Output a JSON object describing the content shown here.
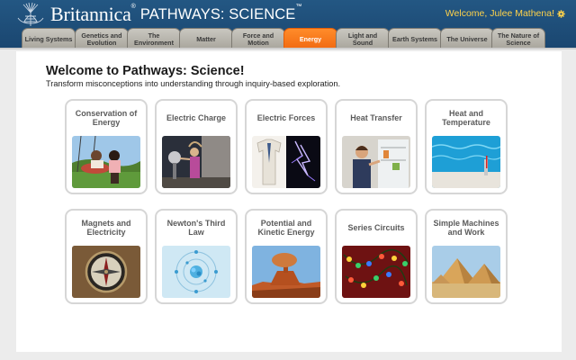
{
  "header": {
    "brand": "Britannica",
    "brand_mark": "®",
    "product": "PATHWAYS: SCIENCE",
    "product_mark": "™",
    "welcome": "Welcome, Julee Mathena!",
    "logo_icon": "thistle-icon",
    "settings_icon": "gear-icon",
    "colors": {
      "header_bg": "#1f4e7a",
      "welcome_text": "#ffd24a",
      "active_tab": "#f26a11"
    }
  },
  "tabs": [
    {
      "label": "Living Systems"
    },
    {
      "label": "Genetics and Evolution"
    },
    {
      "label": "The Environment"
    },
    {
      "label": "Matter"
    },
    {
      "label": "Force and Motion"
    },
    {
      "label": "Energy",
      "active": true
    },
    {
      "label": "Light and Sound"
    },
    {
      "label": "Earth Systems"
    },
    {
      "label": "The Universe"
    },
    {
      "label": "The Nature of Science"
    }
  ],
  "main": {
    "title": "Welcome to Pathways: Science!",
    "subtitle": "Transform misconceptions into understanding through inquiry-based exploration."
  },
  "cards": [
    {
      "title": "Conservation of Energy",
      "image": "kids-on-swing-photo"
    },
    {
      "title": "Electric Charge",
      "image": "static-electricity-photo"
    },
    {
      "title": "Electric Forces",
      "image": "shirt-and-lightning-photo"
    },
    {
      "title": "Heat Transfer",
      "image": "man-at-refrigerator-photo"
    },
    {
      "title": "Heat and Temperature",
      "image": "swimming-pool-photo"
    },
    {
      "title": "Magnets and Electricity",
      "image": "compass-photo"
    },
    {
      "title": "Newton's Third Law",
      "image": "atom-diagram-image"
    },
    {
      "title": "Potential and Kinetic Energy",
      "image": "balanced-rock-photo"
    },
    {
      "title": "Series Circuits",
      "image": "string-lights-photo"
    },
    {
      "title": "Simple Machines and Work",
      "image": "pyramids-photo"
    }
  ]
}
